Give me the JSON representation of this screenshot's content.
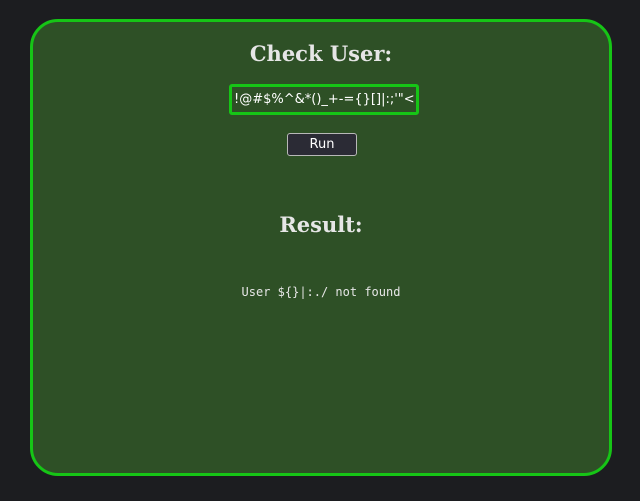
{
  "check": {
    "title": "Check User:",
    "input_value": "!@#$%^&*()_+-={}[]|:;'\"<>,.?/"
  },
  "run_button": {
    "label": "Run"
  },
  "result": {
    "title": "Result:",
    "text": "User ${}|:./ not found"
  },
  "colors": {
    "page_background": "#1c1d20",
    "panel_background": "#2e5026",
    "accent_border": "#16c516",
    "text": "#e6e6e6"
  }
}
